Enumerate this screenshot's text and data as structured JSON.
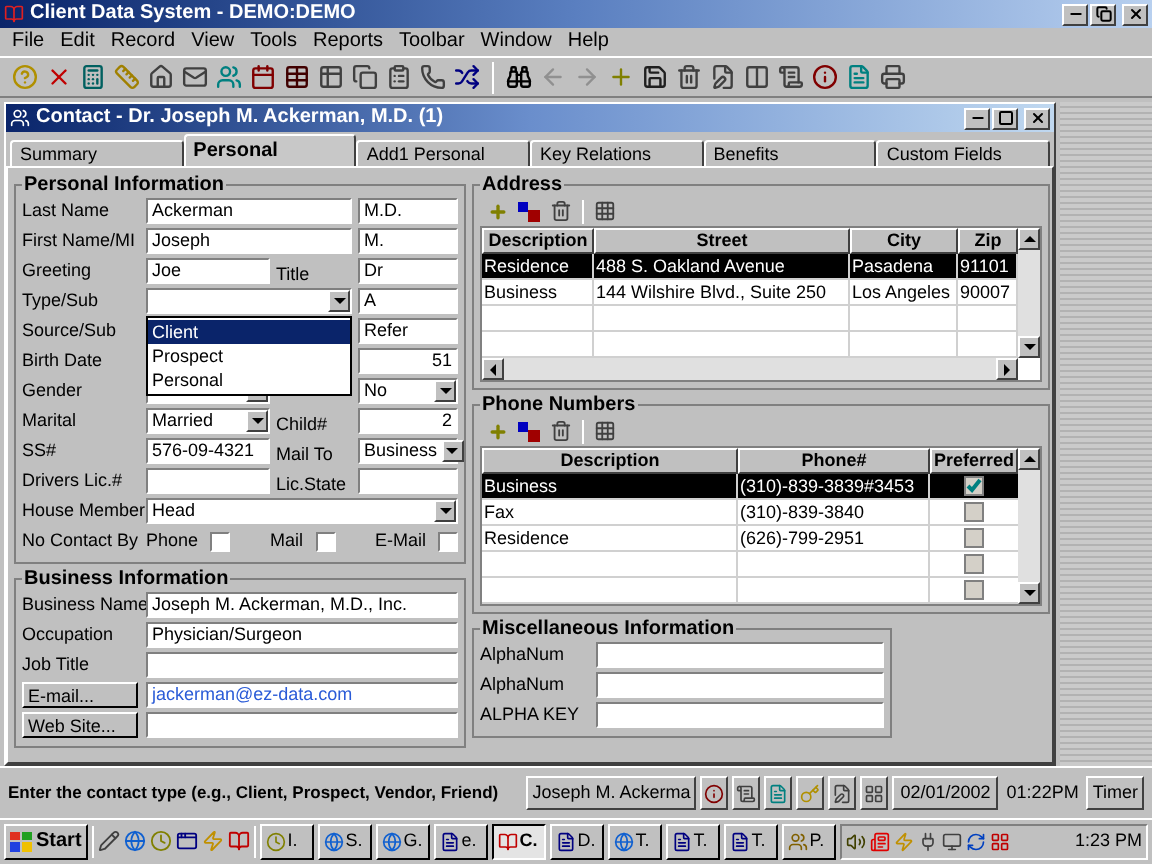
{
  "app": {
    "title": "Client Data System - DEMO:DEMO"
  },
  "menu": [
    "File",
    "Edit",
    "Record",
    "View",
    "Tools",
    "Reports",
    "Toolbar",
    "Window",
    "Help"
  ],
  "contact": {
    "title": "Contact - Dr. Joseph M. Ackerman, M.D. (1)",
    "tabs": [
      {
        "label": "Summary",
        "selected": false
      },
      {
        "label": "Personal",
        "selected": true
      },
      {
        "label": "Add1 Personal",
        "selected": false
      },
      {
        "label": "Key Relations",
        "selected": false
      },
      {
        "label": "Benefits",
        "selected": false
      },
      {
        "label": "Custom Fields",
        "selected": false
      }
    ],
    "personal": {
      "title": "Personal Information",
      "rows": [
        {
          "kind": "long",
          "label": "Last Name",
          "field": {
            "kind": "text",
            "value": "Ackerman"
          },
          "field2": {
            "kind": "text",
            "value": "M.D."
          }
        },
        {
          "kind": "long",
          "label": "First Name/MI",
          "field": {
            "kind": "text",
            "value": "Joseph"
          },
          "field2": {
            "kind": "text",
            "value": "M."
          }
        },
        {
          "kind": "short",
          "label": "Greeting",
          "field": {
            "kind": "text",
            "value": "Joe"
          },
          "label2": "Title",
          "field2": {
            "kind": "text",
            "value": "Dr"
          }
        },
        {
          "kind": "long",
          "label": "Type/Sub",
          "field": {
            "kind": "combo"
          },
          "field2": {
            "kind": "text",
            "value": "A"
          }
        },
        {
          "kind": "long",
          "label": "Source/Sub",
          "field": {
            "kind": "text"
          },
          "field2": {
            "kind": "text",
            "value": "Refer"
          }
        },
        {
          "kind": "short",
          "label": "Birth Date",
          "field": {
            "kind": "text"
          },
          "field2": {
            "kind": "number",
            "value": "51"
          }
        },
        {
          "kind": "short",
          "label": "Gender",
          "field": {
            "kind": "combo"
          },
          "field2": {
            "kind": "combo",
            "value": "No"
          }
        },
        {
          "kind": "short",
          "label": "Marital",
          "field": {
            "kind": "combo",
            "value": "Married"
          },
          "label2": "Child#",
          "field2": {
            "kind": "number",
            "value": "2"
          }
        },
        {
          "kind": "short",
          "label": "SS#",
          "field": {
            "kind": "text",
            "value": "576-09-4321"
          },
          "label2": "Mail To",
          "field2": {
            "kind": "combo",
            "value": "Business"
          }
        },
        {
          "kind": "short",
          "label": "Drivers Lic.#",
          "field": {
            "kind": "text"
          },
          "label2": "Lic.State",
          "field2": {
            "kind": "text"
          }
        },
        {
          "kind": "full",
          "label": "House Member",
          "field": {
            "kind": "combo",
            "value": "Head"
          }
        },
        {
          "kind": "checks",
          "label": "No Contact By",
          "checks": [
            {
              "label": "Phone",
              "checked": false
            },
            {
              "label": "Mail",
              "checked": false
            },
            {
              "label": "E-Mail",
              "checked": false
            }
          ]
        }
      ],
      "dropdown": [
        {
          "label": "Client",
          "selected": true
        },
        {
          "label": "Prospect",
          "selected": false
        },
        {
          "label": "Personal",
          "selected": false
        }
      ]
    },
    "business": {
      "title": "Business Information",
      "rows": [
        {
          "kind": "label",
          "label": "Business Name",
          "field": {
            "kind": "text",
            "value": "Joseph M. Ackerman, M.D., Inc."
          }
        },
        {
          "kind": "label",
          "label": "Occupation",
          "field": {
            "kind": "text",
            "value": "Physician/Surgeon"
          }
        },
        {
          "kind": "label",
          "label": "Job Title",
          "field": {
            "kind": "text"
          }
        },
        {
          "kind": "button",
          "label": "E-mail...",
          "field": {
            "kind": "link",
            "value": "jackerman@ez-data.com"
          }
        },
        {
          "kind": "button",
          "label": "Web Site...",
          "field": {
            "kind": "text"
          }
        }
      ]
    },
    "address": {
      "title": "Address",
      "columns": [
        "Description",
        "Street",
        "City",
        "Zip"
      ],
      "rows": [
        {
          "cells": [
            "Residence",
            "488 S. Oakland Avenue",
            "Pasadena",
            "91101"
          ],
          "selected": true
        },
        {
          "cells": [
            "Business",
            "144 Wilshire Blvd., Suite 250",
            "Los Angeles",
            "90007"
          ],
          "selected": false
        }
      ]
    },
    "phones": {
      "title": "Phone Numbers",
      "columns": [
        "Description",
        "Phone#",
        "Preferred"
      ],
      "rows": [
        {
          "description": "Business",
          "phone": "(310)-839-3839#3453",
          "preferred": true,
          "selected": true
        },
        {
          "description": "Fax",
          "phone": "(310)-839-3840",
          "preferred": false,
          "selected": false
        },
        {
          "description": "Residence",
          "phone": "(626)-799-2951",
          "preferred": false,
          "selected": false
        },
        {
          "preferred": false,
          "selected": false
        },
        {
          "preferred": false,
          "selected": false
        }
      ]
    },
    "misc": {
      "title": "Miscellaneous Information",
      "rows": [
        "AlphaNum",
        "AlphaNum",
        "ALPHA KEY"
      ]
    }
  },
  "status": {
    "message": "Enter the contact type (e.g., Client, Prospect, Vendor, Friend)",
    "user": "Joseph M. Ackerma",
    "date": "02/01/2002",
    "time": "01:22PM",
    "timer": "Timer"
  },
  "taskbar": {
    "start": "Start",
    "tasks": [
      {
        "label": "I.",
        "selected": false
      },
      {
        "label": "S.",
        "selected": false
      },
      {
        "label": "G.",
        "selected": false
      },
      {
        "label": "e.",
        "selected": false
      },
      {
        "label": "C.",
        "selected": true
      },
      {
        "label": "D.",
        "selected": false
      },
      {
        "label": "T.",
        "selected": false
      },
      {
        "label": "T.",
        "selected": false
      },
      {
        "label": "T.",
        "selected": false
      },
      {
        "label": "P.",
        "selected": false
      }
    ],
    "clock": "1:23 PM"
  }
}
